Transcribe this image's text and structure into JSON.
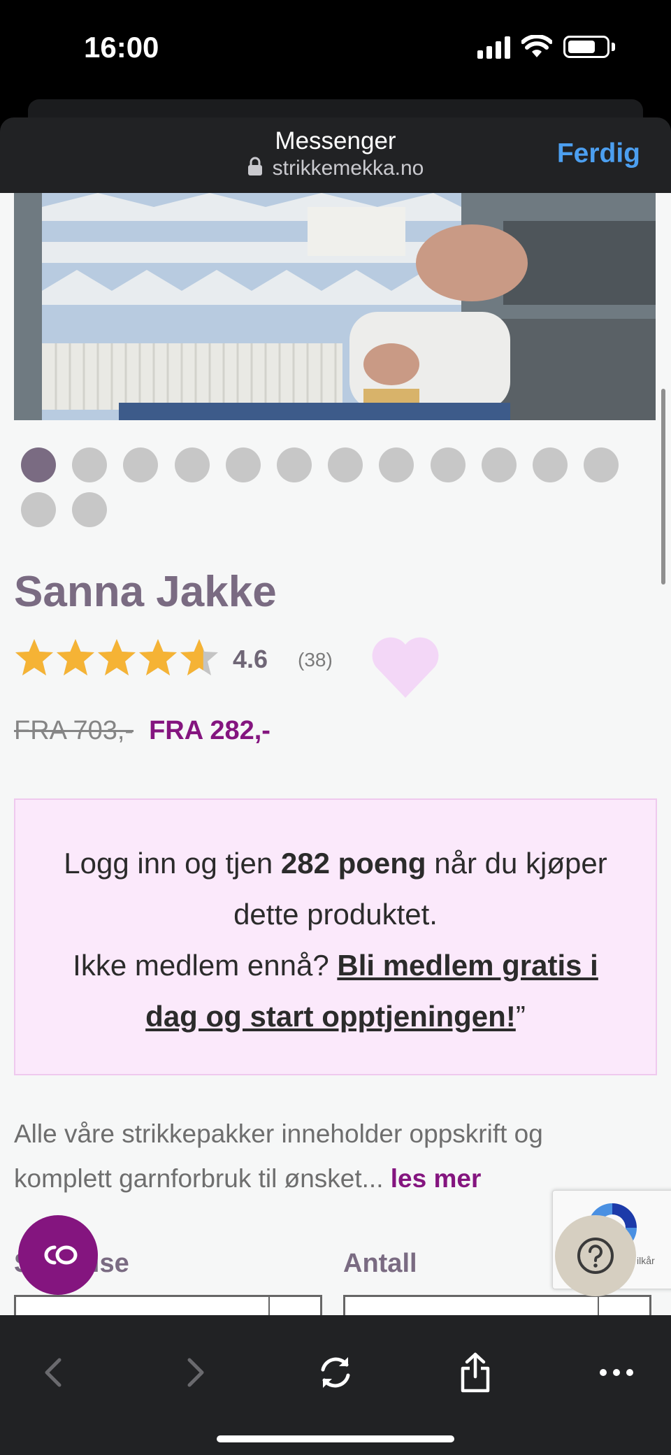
{
  "status_bar": {
    "time": "16:00"
  },
  "browser": {
    "title": "Messenger",
    "url": "strikkemekka.no",
    "done_label": "Ferdig"
  },
  "gallery": {
    "image_count": 14,
    "active_index": 0
  },
  "product": {
    "title": "Sanna Jakke",
    "rating": "4.6",
    "rating_count": "(38)",
    "rating_value": 4.6,
    "old_price": "FRA 703,-",
    "new_price": "FRA 282,-"
  },
  "promo": {
    "line1_prefix": "Logg inn og tjen ",
    "points": "282 poeng",
    "line1_suffix": " når du kjøper dette produktet.",
    "line2_prefix": "Ikke medlem ennå? ",
    "link": "Bli medlem gratis i dag og start opptjeningen!",
    "line2_suffix": "”"
  },
  "description": {
    "text": "Alle våre strikkepakker inneholder oppskrift og komplett garnforbruk til ønsket... ",
    "read_more": "les mer"
  },
  "form": {
    "size_label": "Størrelse",
    "quantity_label": "Antall"
  },
  "recaptcha": {
    "text": "ilkår"
  },
  "colors": {
    "accent": "#84157f",
    "title": "#7a6b82",
    "promo_bg": "#fbe9fb",
    "star": "#f5b335",
    "heart": "#f3d7f7",
    "link_blue": "#4c9ff0"
  }
}
